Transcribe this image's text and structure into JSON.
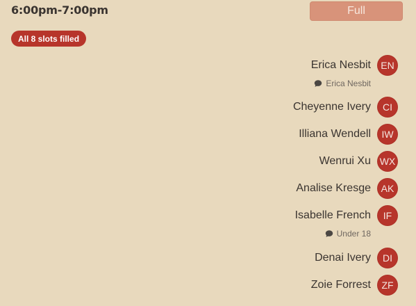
{
  "header": {
    "time_range": "6:00pm-7:00pm",
    "status_button": "Full"
  },
  "badge": {
    "label": "All 8 slots filled"
  },
  "attendees": [
    {
      "name": "Erica Nesbit",
      "initials": "EN",
      "note": "Erica Nesbit"
    },
    {
      "name": "Cheyenne Ivery",
      "initials": "CI"
    },
    {
      "name": "Illiana Wendell",
      "initials": "IW"
    },
    {
      "name": "Wenrui Xu",
      "initials": "WX"
    },
    {
      "name": "Analise Kresge",
      "initials": "AK"
    },
    {
      "name": "Isabelle French",
      "initials": "IF",
      "note": "Under 18"
    },
    {
      "name": "Denai Ivery",
      "initials": "DI"
    },
    {
      "name": "Zoie Forrest",
      "initials": "ZF"
    }
  ],
  "icons": {
    "note": "comment-icon"
  },
  "colors": {
    "background": "#e8d9bd",
    "accent": "#b7352b",
    "full_button": "#d8937a",
    "note_text": "#6f6760"
  }
}
